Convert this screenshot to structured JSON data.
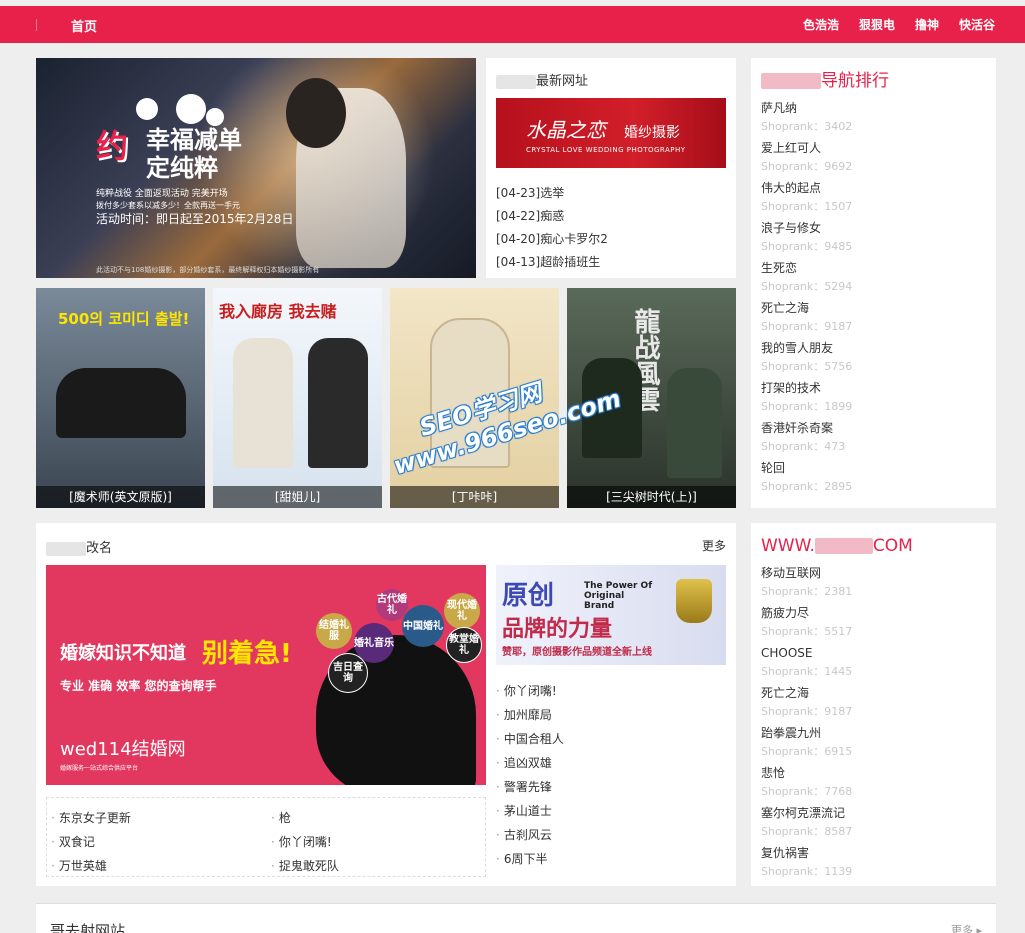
{
  "header": {
    "home": "首页",
    "nav": [
      "色浩浩",
      "狠狠电",
      "撸神",
      "快活谷"
    ]
  },
  "hero": {
    "t_yue": "约",
    "t_line1": "幸福减单",
    "t_line2": "定纯粹",
    "s1": "纯粹战役 全面返现活动 完美开场",
    "s2": "拨付多少套系以减多少！全款再送一手元",
    "s3": "活动时间：即日起至2015年2月28日",
    "s4": "此活动不与108婚纱摄影，部分婚纱套系，最终解释权归本婚纱摄影所有"
  },
  "news": {
    "title_suffix": "最新网址",
    "banner_logo": "水晶之恋",
    "banner_sub": "婚纱摄影",
    "banner_en": "CRYSTAL LOVE WEDDING PHOTOGRAPHY",
    "items": [
      "[04-23]选举",
      "[04-22]痴惑",
      "[04-20]痴心卡罗尔2",
      "[04-13]超龄插班生"
    ]
  },
  "posters": [
    {
      "caption": "[魔术师(英文原版)]",
      "text": "500의 코미디 출발!",
      "bg": "#5a6a7a"
    },
    {
      "caption": "[甜姐儿]",
      "text": "我入廊房 我去赌",
      "bg": "#d9e6f2"
    },
    {
      "caption": "[丁咔咔]",
      "text": "",
      "bg": "#efe0bd"
    },
    {
      "caption": "[三尖树时代(上)]",
      "text": "龍战風雲",
      "bg": "#3c4a3c"
    }
  ],
  "rank1": {
    "title_suffix": "导航排行",
    "items": [
      {
        "name": "萨凡纳",
        "rank": "Shoprank：3402"
      },
      {
        "name": "爱上红可人",
        "rank": "Shoprank：9692"
      },
      {
        "name": "伟大的起点",
        "rank": "Shoprank：1507"
      },
      {
        "name": "浪子与修女",
        "rank": "Shoprank：9485"
      },
      {
        "name": "生死恋",
        "rank": "Shoprank：5294"
      },
      {
        "name": "死亡之海",
        "rank": "Shoprank：9187"
      },
      {
        "name": "我的雪人朋友",
        "rank": "Shoprank：5756"
      },
      {
        "name": "打架的技术",
        "rank": "Shoprank：1899"
      },
      {
        "name": "香港奸杀奇案",
        "rank": "Shoprank：473"
      },
      {
        "name": "轮回",
        "rank": "Shoprank：2895"
      }
    ]
  },
  "rank2": {
    "title_prefix": "WWW.",
    "title_suffix": "COM",
    "items": [
      {
        "name": "移动互联网",
        "rank": "Shoprank：2381"
      },
      {
        "name": "筋疲力尽",
        "rank": "Shoprank：5517"
      },
      {
        "name": "CHOOSE",
        "rank": "Shoprank：1445"
      },
      {
        "name": "死亡之海",
        "rank": "Shoprank：9187"
      },
      {
        "name": "跆拳震九州",
        "rank": "Shoprank：6915"
      },
      {
        "name": "悲怆",
        "rank": "Shoprank：7768"
      },
      {
        "name": "塞尔柯克漂流记",
        "rank": "Shoprank：8587"
      },
      {
        "name": "复仇祸害",
        "rank": "Shoprank：1139"
      }
    ]
  },
  "rename": {
    "title_suffix": "改名",
    "more": "更多",
    "bigad": {
      "headline": "婚嫁知识不知道",
      "headline_yellow": "别着急!",
      "sub": "专业 准确 效率 您的查询帮手",
      "logo": "wed114结婚网",
      "logo_small": "婚嫁服务一站式综合供应平台",
      "circles": [
        "结婚礼服",
        "古代婚礼",
        "婚礼音乐",
        "中国婚礼",
        "现代婚礼",
        "吉日查询",
        "教堂婚礼"
      ]
    },
    "smallad": {
      "a": "原创",
      "b": "The Power Of Original Brand",
      "c": "品牌的力量",
      "d": "赞耶，原创摄影作品频道全新上线"
    },
    "left_col1": [
      "东京女子更新",
      "双食记",
      "万世英雄"
    ],
    "left_col2": [
      "枪",
      "你丫闭嘴!",
      "捉鬼敢死队"
    ],
    "right_list": [
      "你丫闭嘴!",
      "加州靡局",
      "中国合租人",
      "追凶双雄",
      "警署先锋",
      "茅山道士",
      "古刹风云",
      "6周下半"
    ]
  },
  "bottom": {
    "title": "哥去射网站",
    "more": "更多"
  },
  "watermark": {
    "line1": "SEO学习网",
    "line2": "www.966seo.com"
  }
}
